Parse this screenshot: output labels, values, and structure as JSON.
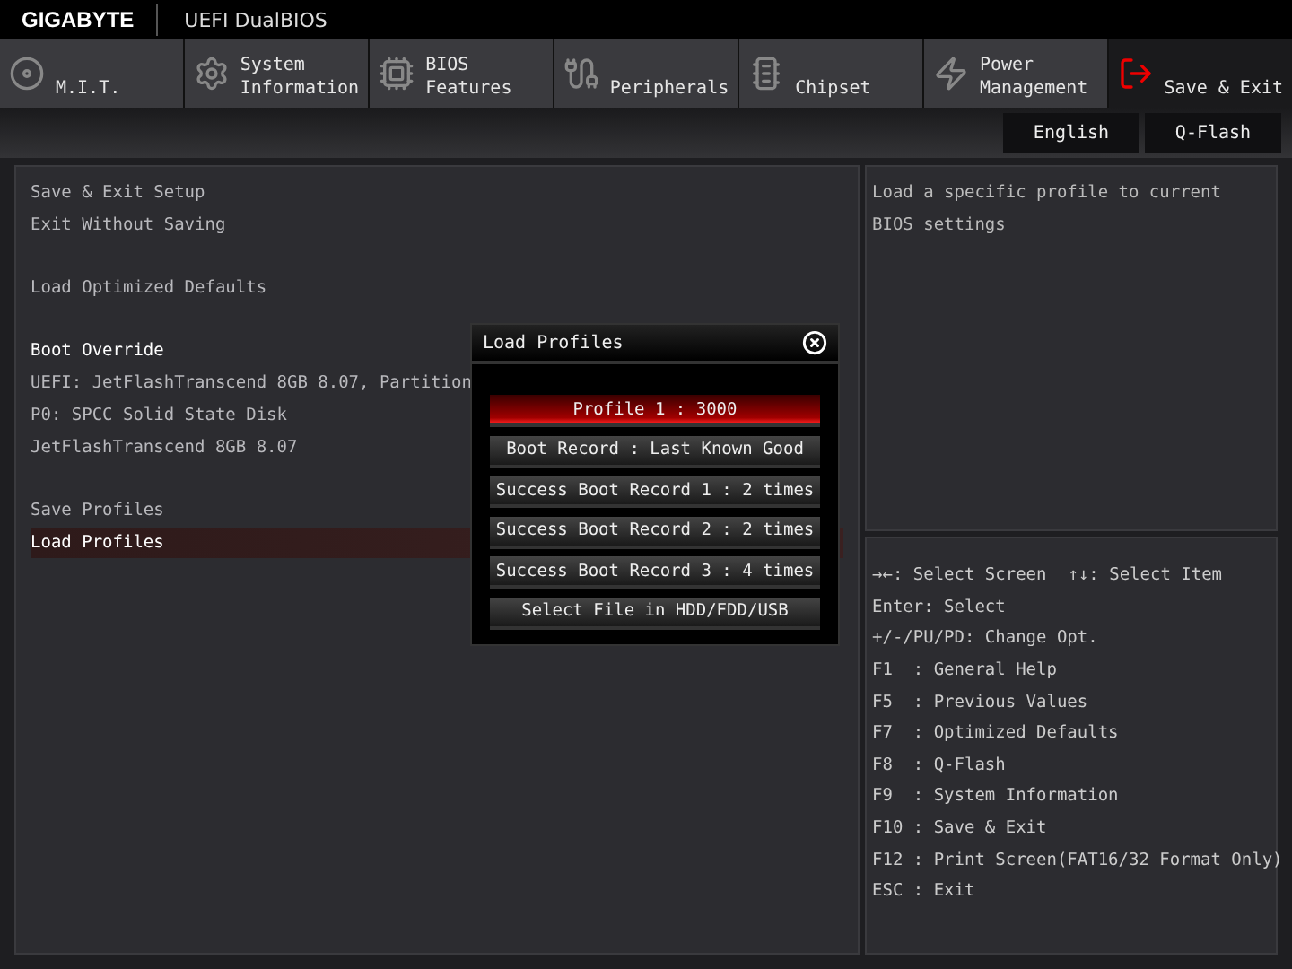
{
  "header": {
    "brand": "GIGABYTE",
    "title": "UEFI DualBIOS"
  },
  "tabs": [
    {
      "label": "M.I.T.",
      "selected": false
    },
    {
      "label": "System\nInformation",
      "selected": false
    },
    {
      "label": "BIOS\nFeatures",
      "selected": false
    },
    {
      "label": "Peripherals",
      "selected": false
    },
    {
      "label": "Chipset",
      "selected": false
    },
    {
      "label": "Power\nManagement",
      "selected": false
    },
    {
      "label": "Save & Exit",
      "selected": true
    }
  ],
  "toolbar": [
    "English",
    "Q-Flash"
  ],
  "menu": [
    {
      "kind": "action",
      "label": "Save & Exit Setup",
      "selected": false
    },
    {
      "kind": "action",
      "label": "Exit Without Saving",
      "selected": false
    },
    {
      "kind": "gap"
    },
    {
      "kind": "action",
      "label": "Load Optimized Defaults",
      "selected": false
    },
    {
      "kind": "gap"
    },
    {
      "kind": "heading",
      "label": "Boot Override"
    },
    {
      "kind": "action",
      "label": "UEFI: JetFlashTranscend 8GB 8.07, Partition",
      "selected": false
    },
    {
      "kind": "action",
      "label": "P0: SPCC Solid State Disk",
      "selected": false
    },
    {
      "kind": "action",
      "label": "JetFlashTranscend 8GB 8.07",
      "selected": false
    },
    {
      "kind": "gap"
    },
    {
      "kind": "action",
      "label": "Save Profiles",
      "selected": false
    },
    {
      "kind": "action",
      "label": "Load Profiles",
      "selected": true
    }
  ],
  "description": "Load a specific profile to current BIOS settings",
  "help": [
    [
      "→←: Select Screen",
      "↑↓: Select Item"
    ],
    [
      "Enter: Select"
    ],
    [
      "+/-/PU/PD: Change Opt."
    ],
    [
      "F1  : General Help"
    ],
    [
      "F5  : Previous Values"
    ],
    [
      "F7  : Optimized Defaults"
    ],
    [
      "F8  : Q-Flash"
    ],
    [
      "F9  : System Information"
    ],
    [
      "F10 : Save & Exit"
    ],
    [
      "F12 : Print Screen(FAT16/32 Format Only)"
    ],
    [
      "ESC : Exit"
    ]
  ],
  "dialog": {
    "title": "Load Profiles",
    "options": [
      {
        "label": "Profile 1 : 3000",
        "selected": true
      },
      {
        "label": "Boot Record : Last Known Good",
        "selected": false
      },
      {
        "label": "Success Boot Record 1 : 2 times",
        "selected": false
      },
      {
        "label": "Success Boot Record 2 : 2 times",
        "selected": false
      },
      {
        "label": "Success Boot Record 3 : 4 times",
        "selected": false
      },
      {
        "label": "Select File in HDD/FDD/USB",
        "selected": false
      }
    ]
  }
}
